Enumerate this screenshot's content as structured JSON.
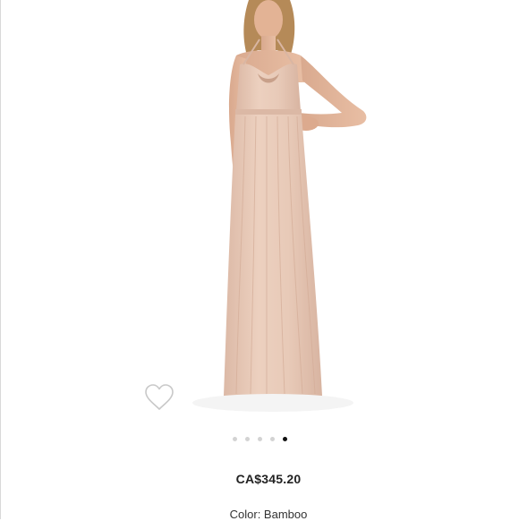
{
  "product": {
    "price": "CA$345.20",
    "color_label": "Color: Bamboo",
    "dress_color": "#e7c8b6",
    "image_count": 5,
    "active_image_index": 5
  },
  "icons": {
    "favorite": "heart-outline-icon"
  }
}
